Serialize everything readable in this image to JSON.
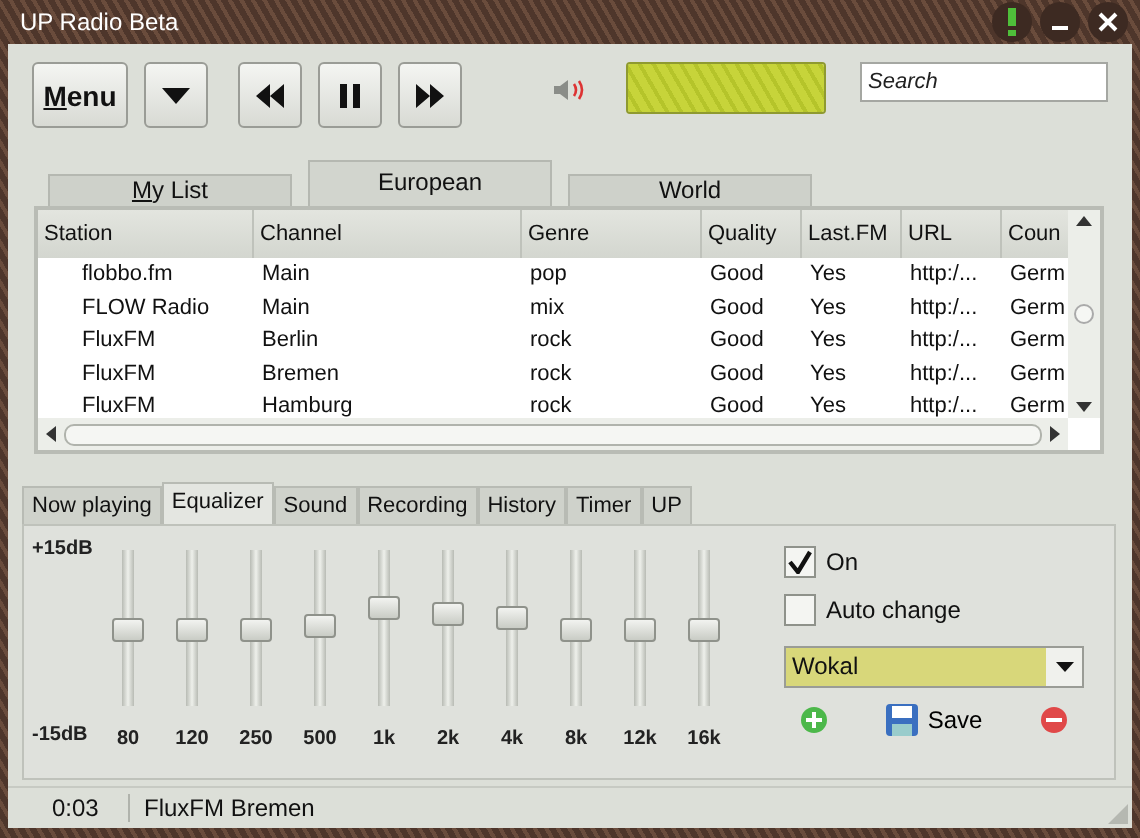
{
  "window": {
    "title": "UP Radio Beta"
  },
  "toolbar": {
    "menu_button": {
      "label": "Menu",
      "underline_first": true
    },
    "volume": {
      "level": 1.0
    },
    "search": {
      "placeholder": "Search"
    }
  },
  "list_tabs": [
    {
      "label": "My List",
      "selected": false,
      "underline_first": true
    },
    {
      "label": "European",
      "selected": true,
      "underline_first": false
    },
    {
      "label": "World",
      "selected": false,
      "underline_first": false
    }
  ],
  "table": {
    "columns": [
      "Station",
      "Channel",
      "Genre",
      "Quality",
      "Last.FM",
      "URL",
      "Coun"
    ],
    "rows": [
      [
        "flobbo.fm",
        "Main",
        "pop",
        "Good",
        "Yes",
        "http:/...",
        "Germ"
      ],
      [
        "FLOW Radio",
        "Main",
        "mix",
        "Good",
        "Yes",
        "http:/...",
        "Germ"
      ],
      [
        "FluxFM",
        "Berlin",
        "rock",
        "Good",
        "Yes",
        "http:/...",
        "Germ"
      ],
      [
        "FluxFM",
        "Bremen",
        "rock",
        "Good",
        "Yes",
        "http:/...",
        "Germ"
      ],
      [
        "FluxFM",
        "Hamburg",
        "rock",
        "Good",
        "Yes",
        "http:/...",
        "Germ"
      ]
    ]
  },
  "panel_tabs": [
    {
      "label": "Now playing",
      "selected": false
    },
    {
      "label": "Equalizer",
      "selected": true
    },
    {
      "label": "Sound",
      "selected": false
    },
    {
      "label": "Recording",
      "selected": false
    },
    {
      "label": "History",
      "selected": false
    },
    {
      "label": "Timer",
      "selected": false
    },
    {
      "label": "UP",
      "selected": false
    }
  ],
  "equalizer": {
    "scale_top": "+15dB",
    "scale_bottom": "-15dB",
    "bands": [
      {
        "label": "80",
        "level": 0.5
      },
      {
        "label": "120",
        "level": 0.5
      },
      {
        "label": "250",
        "level": 0.5
      },
      {
        "label": "500",
        "level": 0.53
      },
      {
        "label": "1k",
        "level": 0.66
      },
      {
        "label": "2k",
        "level": 0.62
      },
      {
        "label": "4k",
        "level": 0.59
      },
      {
        "label": "8k",
        "level": 0.5
      },
      {
        "label": "12k",
        "level": 0.5
      },
      {
        "label": "16k",
        "level": 0.5
      }
    ],
    "options": [
      {
        "label": "On",
        "checked": true
      },
      {
        "label": "Auto change",
        "checked": false
      }
    ],
    "preset": "Wokal",
    "save_label": "Save"
  },
  "status_bar": {
    "time": "0:03",
    "station": "FluxFM Bremen"
  }
}
